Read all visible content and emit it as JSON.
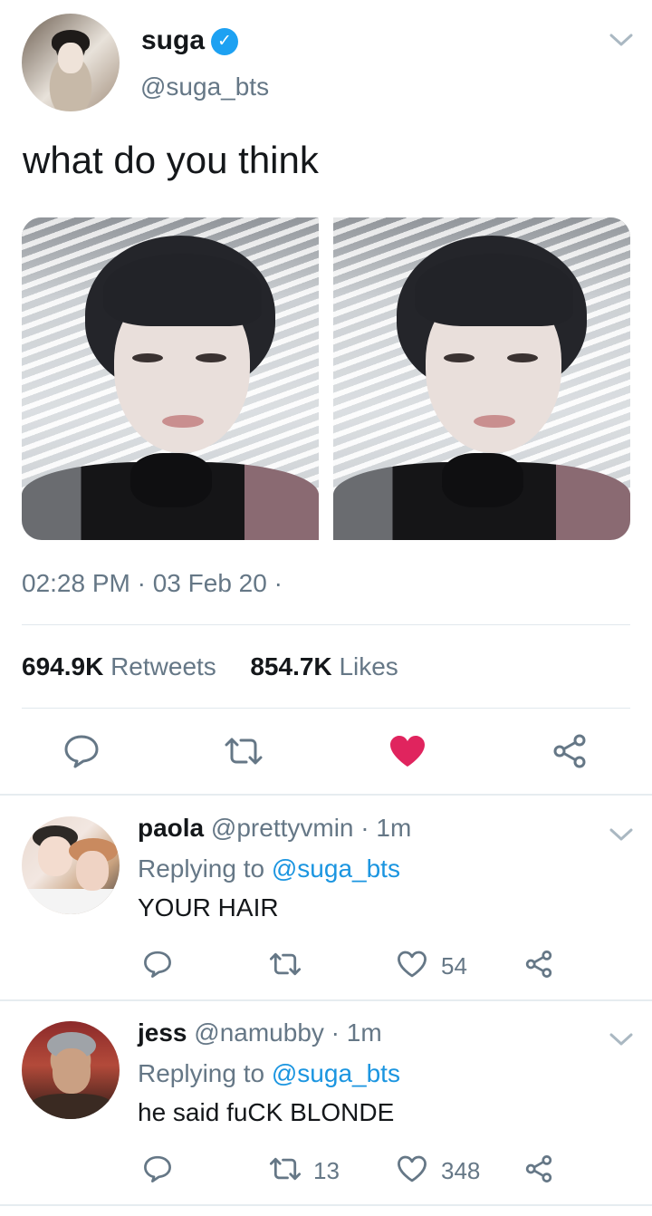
{
  "main_tweet": {
    "display_name": "suga",
    "handle": "@suga_bts",
    "verified_icon": "✓",
    "text": "what do you think",
    "timestamp": "02:28 PM · 03 Feb 20 ·",
    "retweets_count": "694.9K",
    "retweets_label": "Retweets",
    "likes_count": "854.7K",
    "likes_label": "Likes",
    "liked": true,
    "images": [
      "photo-selfie-1",
      "photo-selfie-2"
    ],
    "actions": [
      "reply-icon",
      "retweet-icon",
      "heart-icon-filled",
      "share-icon"
    ]
  },
  "replies": [
    {
      "display_name": "paola",
      "handle": "@prettyvmin",
      "time": "· 1m",
      "replying_prefix": "Replying to",
      "replying_to": "@suga_bts",
      "text": "YOUR HAIR",
      "retweets": "",
      "likes": "54"
    },
    {
      "display_name": "jess",
      "handle": "@namubby",
      "time": "· 1m",
      "replying_prefix": "Replying to",
      "replying_to": "@suga_bts",
      "text": "he said fuCK BLONDE",
      "retweets": "13",
      "likes": "348"
    }
  ],
  "colors": {
    "accent": "#1da1f2",
    "link": "#1b95e0",
    "like": "#e0245e",
    "muted": "#657786"
  },
  "icons": {
    "caret": "chevron-down-icon"
  }
}
